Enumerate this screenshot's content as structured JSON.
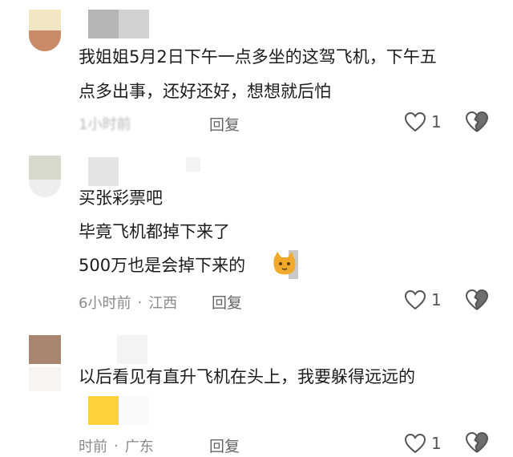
{
  "comments": [
    {
      "lines": [
        "我姐姐5月2日下午一点多坐的这驾飞机，下午五",
        "点多出事，还好还好，想想就后怕"
      ],
      "time": "1小时前",
      "location": "",
      "reply_label": "回复",
      "likes": "1"
    },
    {
      "lines": [
        "买张彩票吧",
        "毕竟飞机都掉下来了",
        "500万也是会掉下来的"
      ],
      "time": "6小时前",
      "location": "江西",
      "reply_label": "回复",
      "likes": "1"
    },
    {
      "lines": [
        "以后看见有直升飞机在头上，我要躲得远远的"
      ],
      "time": "时前",
      "location": "广东",
      "reply_label": "回复",
      "likes": "1"
    }
  ],
  "icons": {
    "like": "heart-outline-icon",
    "dislike": "broken-heart-icon",
    "emoji": "cat-emoji-icon"
  },
  "colors": {
    "meta_text": "#8a8a8a",
    "icon_stroke": "#555555"
  }
}
